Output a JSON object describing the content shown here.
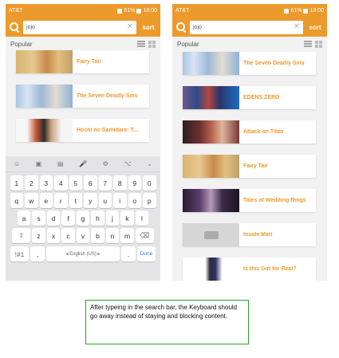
{
  "colors": {
    "accent": "#ed9a2c",
    "title_text": "#ed9a2c",
    "caption_border": "#2aa12a"
  },
  "left": {
    "status": {
      "carrier": "AT&T",
      "battery": "61%",
      "time": "18:00"
    },
    "search": {
      "value": "jojo",
      "sort_label": "sort"
    },
    "section_title": "Popular",
    "items": [
      {
        "title": "Fairy Tail",
        "thumb": "fairy"
      },
      {
        "title": "The Seven Deadly Sins",
        "thumb": "seven"
      },
      {
        "title": "Hoshi no Samidare: T...",
        "thumb": "hoshi"
      }
    ],
    "keyboard": {
      "toolbar": [
        "☺",
        "▣",
        "▤",
        "🎤",
        "⚙",
        "⌥",
        "⌄"
      ],
      "row1": [
        "1",
        "2",
        "3",
        "4",
        "5",
        "6",
        "7",
        "8",
        "9",
        "0"
      ],
      "row2": [
        "q",
        "w",
        "e",
        "r",
        "t",
        "y",
        "u",
        "i",
        "o",
        "p"
      ],
      "row3": [
        "a",
        "s",
        "d",
        "f",
        "g",
        "h",
        "j",
        "k",
        "l"
      ],
      "row4_shift": "⇧",
      "row4": [
        "z",
        "x",
        "c",
        "v",
        "b",
        "n",
        "m"
      ],
      "row4_backspace": "⌫",
      "row5_symbols": "!#1",
      "row5_comma": ",",
      "row5_space": "◂ English (US) ▸",
      "row5_period": ".",
      "row5_done": "Done"
    }
  },
  "right": {
    "status": {
      "carrier": "AT&T",
      "battery": "61%",
      "time": "18:00"
    },
    "search": {
      "value": "jojo",
      "sort_label": "sort"
    },
    "section_title": "Popular",
    "items": [
      {
        "title": "The Seven Deadly Sins",
        "thumb": "seven"
      },
      {
        "title": "EDENS ZERO",
        "thumb": "edens"
      },
      {
        "title": "Attack on Titan",
        "thumb": "titan"
      },
      {
        "title": "Fairy Tail",
        "thumb": "fairy"
      },
      {
        "title": "Tales of Wedding Rings",
        "thumb": "rings"
      },
      {
        "title": "Inside Mari",
        "thumb": "mari"
      },
      {
        "title": "Is this Girl for Real?",
        "thumb": "girl"
      }
    ]
  },
  "caption": "After typeing in the search bar, the Keyboard should go away instead of staying and blocking content."
}
